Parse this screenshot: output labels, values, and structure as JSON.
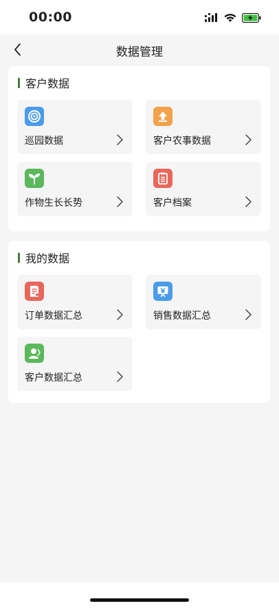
{
  "status_bar": {
    "time": "00:00",
    "icons": [
      "signal-icon",
      "wifi-icon",
      "battery-charging-icon"
    ]
  },
  "nav": {
    "title": "数据管理",
    "back_icon": "chevron-left-icon"
  },
  "sections": [
    {
      "title": "客户数据",
      "accent": "#4a7a3c",
      "items": [
        {
          "label": "巡园数据",
          "icon": "patrol-target-icon",
          "color": "#4a9be8"
        },
        {
          "label": "客户农事数据",
          "icon": "upload-arrow-icon",
          "color": "#f2a24a"
        },
        {
          "label": "作物生长长势",
          "icon": "sprout-icon",
          "color": "#5cb85c"
        },
        {
          "label": "客户档案",
          "icon": "document-file-icon",
          "color": "#e8675b"
        }
      ]
    },
    {
      "title": "我的数据",
      "accent": "#4a7a3c",
      "items": [
        {
          "label": "订单数据汇总",
          "icon": "order-list-icon",
          "color": "#e8675b"
        },
        {
          "label": "销售数据汇总",
          "icon": "sales-yuan-icon",
          "color": "#4a9be8"
        },
        {
          "label": "客户数据汇总",
          "icon": "customer-person-icon",
          "color": "#5cb85c"
        }
      ]
    }
  ]
}
